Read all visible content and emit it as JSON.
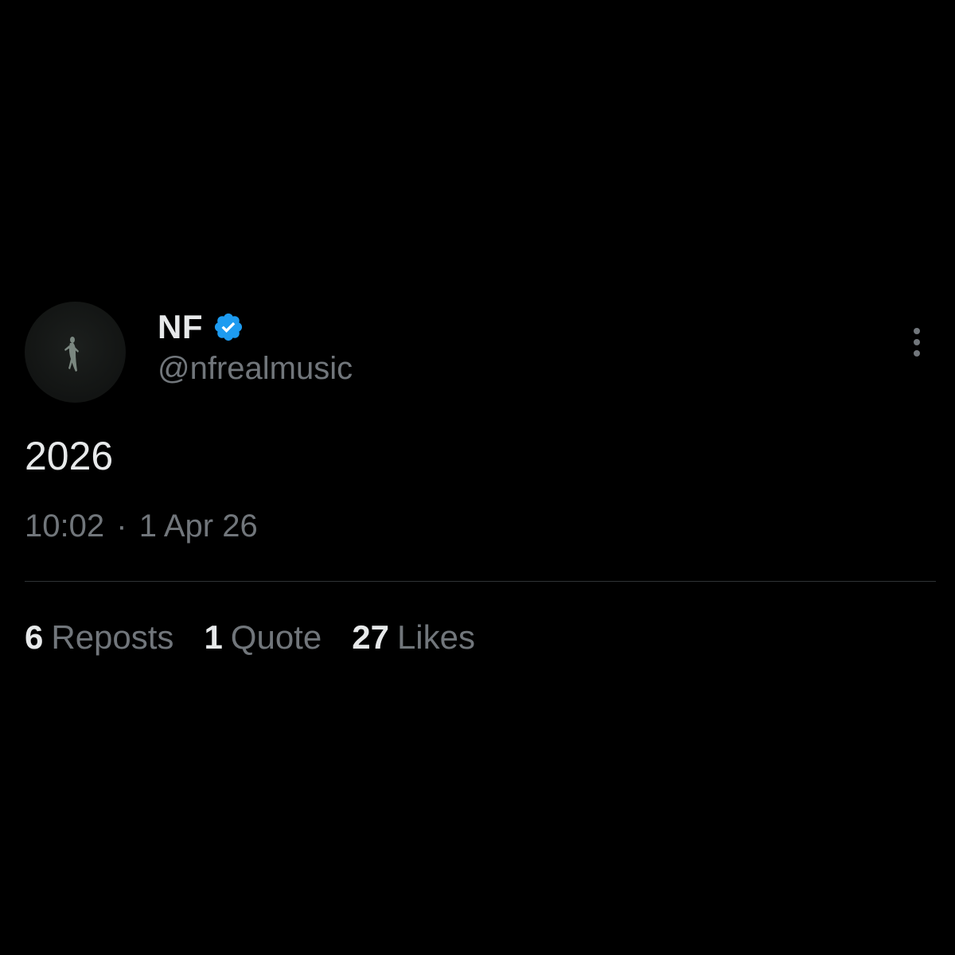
{
  "tweet": {
    "author": {
      "display_name": "NF",
      "handle": "@nfrealmusic",
      "verified": true,
      "avatar_icon": "avatar-figure-icon"
    },
    "text": "2026",
    "time": "10:02",
    "separator": "·",
    "date": "1 Apr 26",
    "more_icon": "more-vertical-icon",
    "stats": [
      {
        "count": "6",
        "label": "Reposts"
      },
      {
        "count": "1",
        "label": "Quote"
      },
      {
        "count": "27",
        "label": "Likes"
      }
    ]
  },
  "colors": {
    "background": "#000000",
    "primary_text": "#e7e9ea",
    "secondary_text": "#71767b",
    "verified_blue": "#1d9bf0",
    "divider": "#2f3336"
  }
}
